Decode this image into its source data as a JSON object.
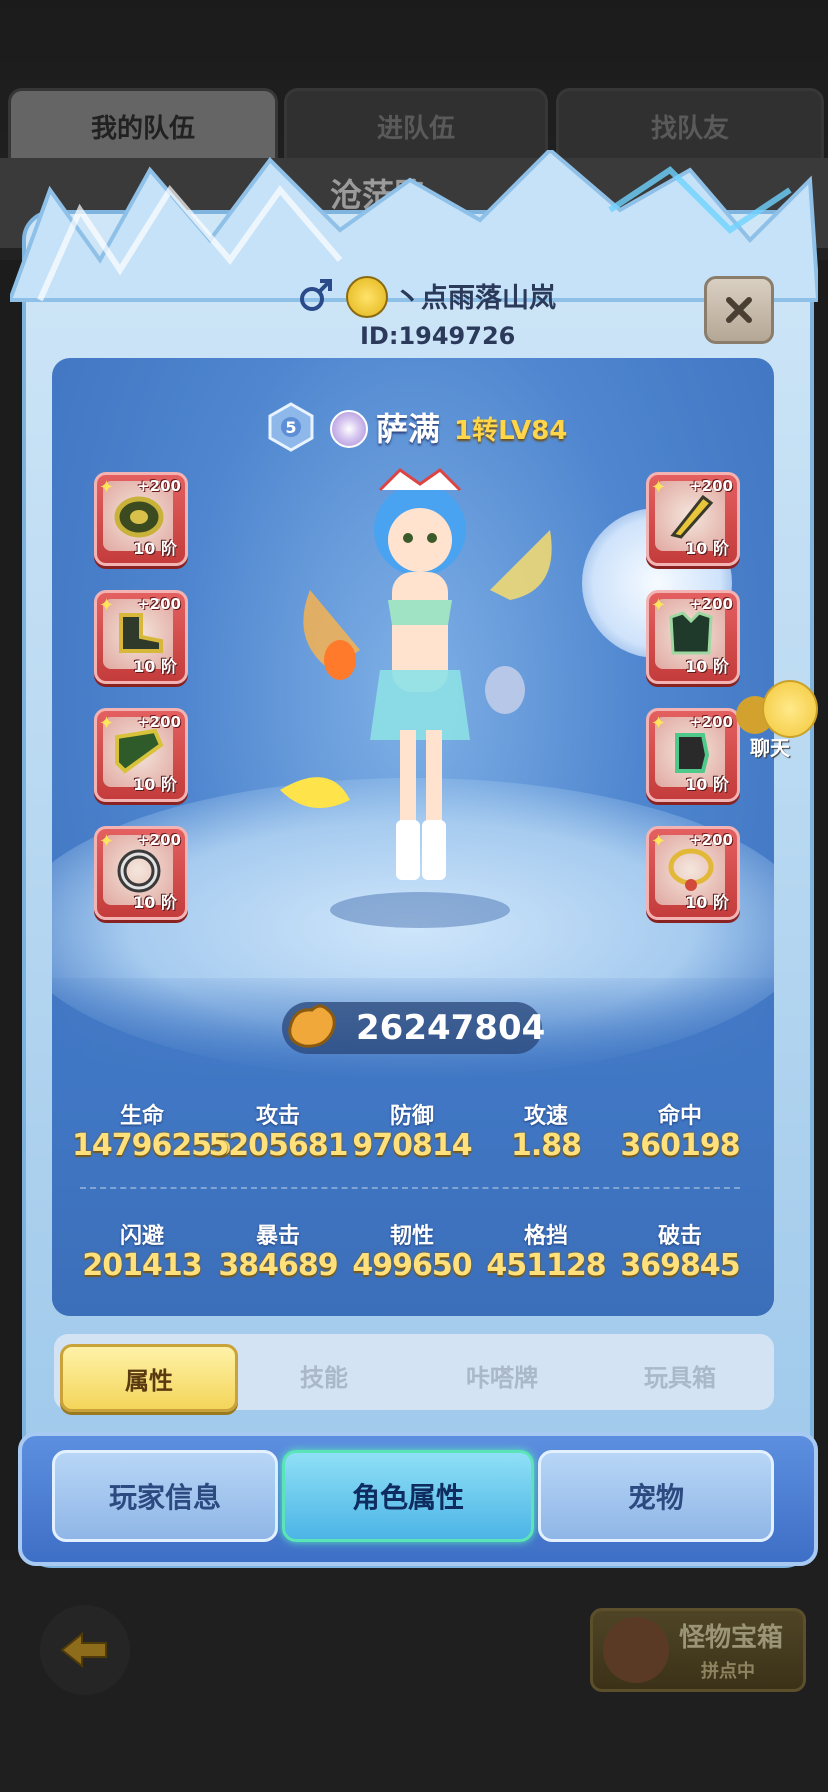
{
  "background": {
    "tabs": [
      "我的队伍",
      "进队伍",
      "找队友"
    ],
    "team_name": "沧茫路",
    "chest_title": "怪物宝箱",
    "chest_status": "拼点中"
  },
  "player": {
    "name": "丶点雨落山岚",
    "id": "ID:1949726",
    "gender": "male"
  },
  "character": {
    "rank": "5",
    "class": "萨满",
    "level": "1转LV84"
  },
  "equipment": {
    "left": [
      {
        "bonus": "+200",
        "tier": "10 阶",
        "icon": "coin-icon"
      },
      {
        "bonus": "+200",
        "tier": "10 阶",
        "icon": "boot-icon"
      },
      {
        "bonus": "+200",
        "tier": "10 阶",
        "icon": "bracer-icon"
      },
      {
        "bonus": "+200",
        "tier": "10 阶",
        "icon": "ring-icon"
      }
    ],
    "right": [
      {
        "bonus": "+200",
        "tier": "10 阶",
        "icon": "staff-icon"
      },
      {
        "bonus": "+200",
        "tier": "10 阶",
        "icon": "armor-icon"
      },
      {
        "bonus": "+200",
        "tier": "10 阶",
        "icon": "glove-icon"
      },
      {
        "bonus": "+200",
        "tier": "10 阶",
        "icon": "necklace-icon"
      }
    ]
  },
  "power": "26247804",
  "stats": {
    "row1": [
      {
        "label": "生命",
        "value": "14796255"
      },
      {
        "label": "攻击",
        "value": "5205681"
      },
      {
        "label": "防御",
        "value": "970814"
      },
      {
        "label": "攻速",
        "value": "1.88"
      },
      {
        "label": "命中",
        "value": "360198"
      }
    ],
    "row2": [
      {
        "label": "闪避",
        "value": "201413"
      },
      {
        "label": "暴击",
        "value": "384689"
      },
      {
        "label": "韧性",
        "value": "499650"
      },
      {
        "label": "格挡",
        "value": "451128"
      },
      {
        "label": "破击",
        "value": "369845"
      }
    ]
  },
  "subtabs": [
    "属性",
    "技能",
    "咔嗒牌",
    "玩具箱"
  ],
  "bottom_tabs": [
    "玩家信息",
    "角色属性",
    "宠物"
  ],
  "chat_label": "聊天",
  "colors": {
    "accent_gold": "#ffe07a",
    "slot_red": "#d44a4a",
    "panel_blue": "#4f86cf"
  }
}
